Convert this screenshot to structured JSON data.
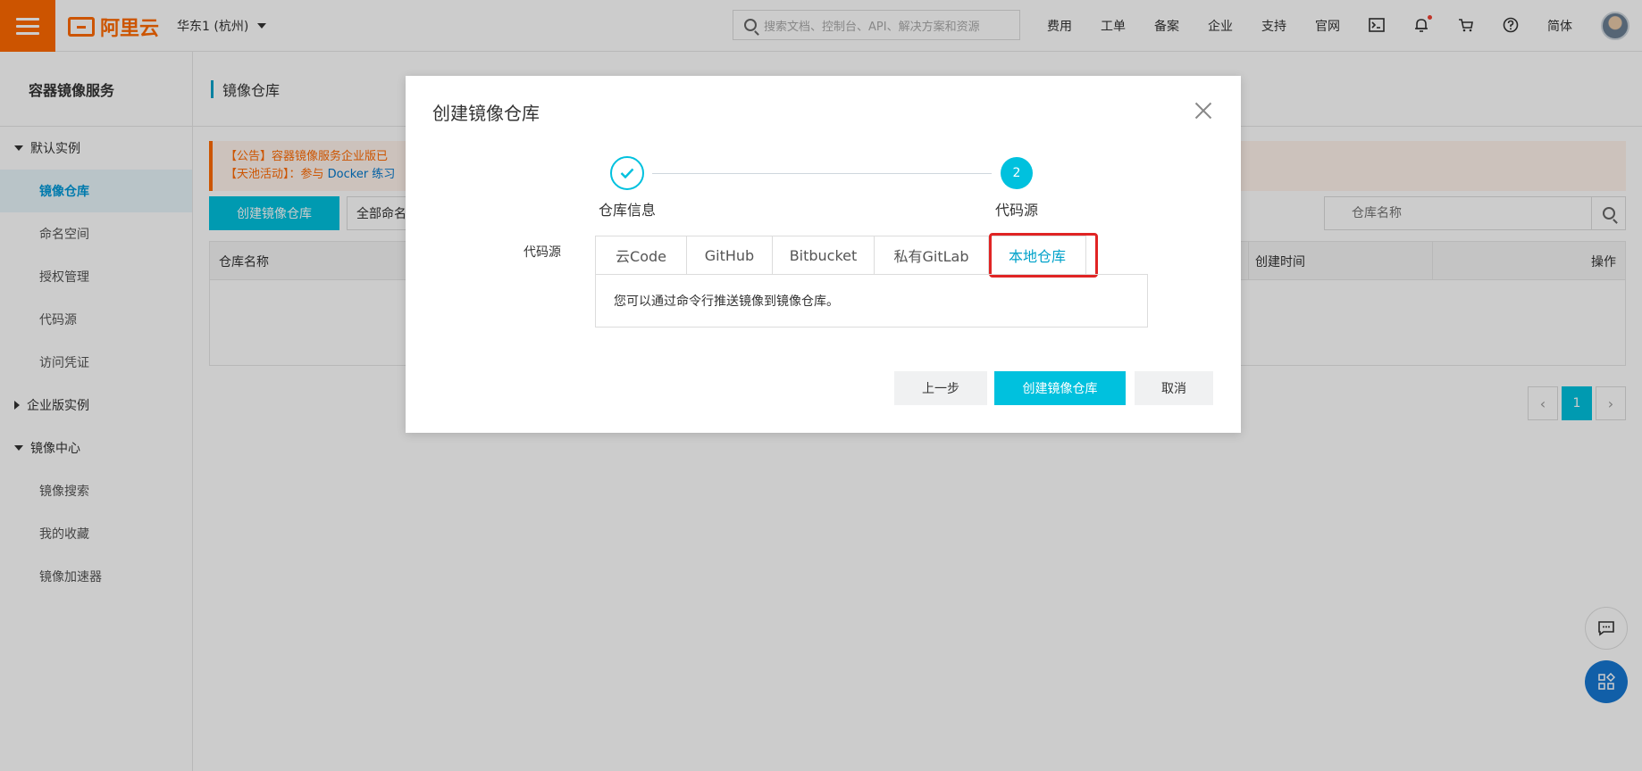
{
  "topbar": {
    "logo_text": "阿里云",
    "region": "华东1 (杭州)",
    "search_placeholder": "搜索文档、控制台、API、解决方案和资源",
    "nav": [
      "费用",
      "工单",
      "备案",
      "企业",
      "支持",
      "官网"
    ],
    "language": "简体",
    "icons": [
      "terminal-icon",
      "bell-icon",
      "cart-icon",
      "help-icon"
    ]
  },
  "sidebar": {
    "title": "容器镜像服务",
    "groups": [
      {
        "label": "默认实例",
        "expanded": true,
        "items": [
          "镜像仓库",
          "命名空间",
          "授权管理",
          "代码源",
          "访问凭证"
        ]
      },
      {
        "label": "企业版实例",
        "expanded": false,
        "items": []
      },
      {
        "label": "镜像中心",
        "expanded": true,
        "items": [
          "镜像搜索",
          "我的收藏",
          "镜像加速器"
        ]
      }
    ],
    "active_item": "镜像仓库"
  },
  "main": {
    "page_title": "镜像仓库",
    "notice_line1": "【公告】容器镜像服务企业版已",
    "notice_line2_prefix": "【天池活动】：参与",
    "notice_line2_link": "Docker 练习",
    "create_button": "创建镜像仓库",
    "namespace_select": "全部命名",
    "name_search_placeholder": "仓库名称",
    "table_headers": {
      "name": "仓库名称",
      "created": "创建时间",
      "actions": "操作"
    },
    "pagination": {
      "current_page": "1"
    }
  },
  "modal": {
    "title": "创建镜像仓库",
    "steps": [
      {
        "label": "仓库信息",
        "status": "done"
      },
      {
        "label": "代码源",
        "status": "current",
        "number": "2"
      }
    ],
    "field_label": "代码源",
    "tabs": [
      "云Code",
      "GitHub",
      "Bitbucket",
      "私有GitLab",
      "本地仓库"
    ],
    "active_tab": "本地仓库",
    "panel_text": "您可以通过命令行推送镜像到镜像仓库。",
    "buttons": {
      "prev": "上一步",
      "create": "创建镜像仓库",
      "cancel": "取消"
    }
  },
  "colors": {
    "brand": "#ff6a00",
    "primary": "#00c1de",
    "highlight": "#e02424"
  }
}
